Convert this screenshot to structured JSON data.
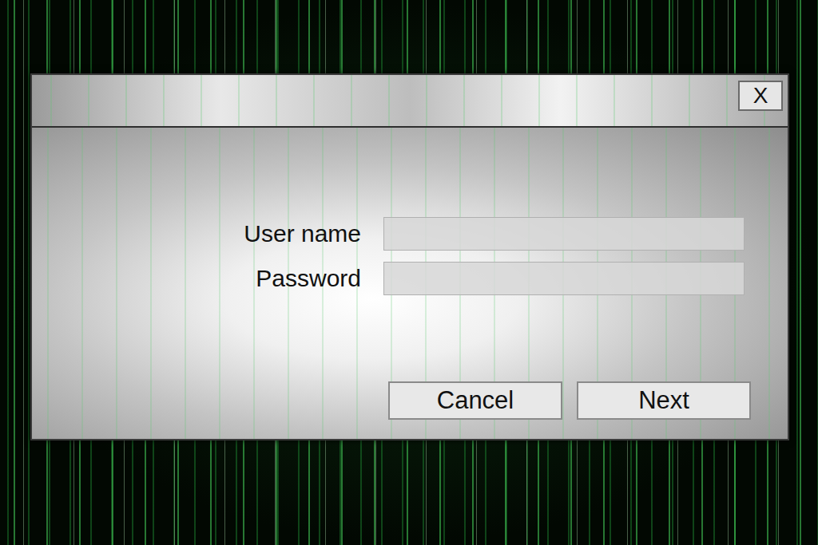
{
  "dialog": {
    "close_button": "X"
  },
  "fields": [
    {
      "label": "User name",
      "kind": "text"
    },
    {
      "label": "Password",
      "kind": "password"
    }
  ],
  "buttons": [
    "Cancel",
    "Next"
  ]
}
